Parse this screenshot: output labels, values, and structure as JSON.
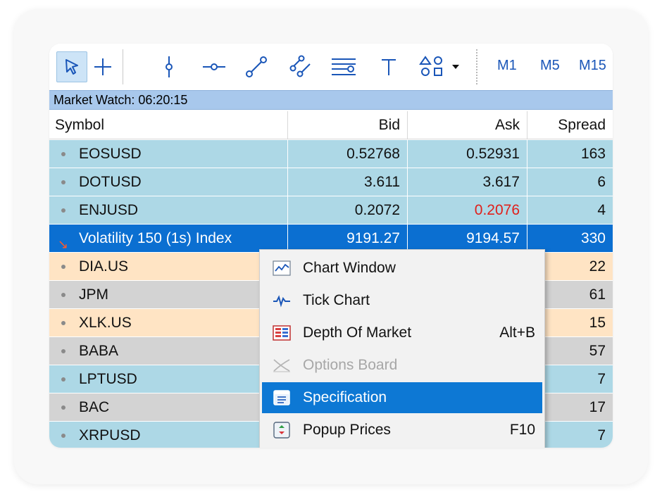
{
  "toolbar": {
    "tools": [
      {
        "icon": "cursor-icon"
      },
      {
        "icon": "crosshair-icon"
      },
      {
        "icon": "vertical-line-icon"
      },
      {
        "icon": "horizontal-line-icon"
      },
      {
        "icon": "trend-line-icon"
      },
      {
        "icon": "channel-icon"
      },
      {
        "icon": "fibonacci-icon"
      },
      {
        "icon": "text-icon"
      },
      {
        "icon": "shapes-icon"
      }
    ],
    "periods": [
      "M1",
      "M5",
      "M15"
    ]
  },
  "market_watch": {
    "title": "Market Watch: 06:20:15",
    "columns": [
      "Symbol",
      "Bid",
      "Ask",
      "Spread"
    ],
    "rows": [
      {
        "symbol": "EOSUSD",
        "bid": "0.52768",
        "ask": "0.52931",
        "spread": "163"
      },
      {
        "symbol": "DOTUSD",
        "bid": "3.611",
        "ask": "3.617",
        "spread": "6"
      },
      {
        "symbol": "ENJUSD",
        "bid": "0.2072",
        "ask": "0.2076",
        "spread": "4"
      },
      {
        "symbol": "Volatility 150 (1s) Index",
        "bid": "9191.27",
        "ask": "9194.57",
        "spread": "330"
      },
      {
        "symbol": "DIA.US",
        "bid": "",
        "ask": "",
        "spread": "22"
      },
      {
        "symbol": "JPM",
        "bid": "",
        "ask": "",
        "spread": "61"
      },
      {
        "symbol": "XLK.US",
        "bid": "",
        "ask": "",
        "spread": "15"
      },
      {
        "symbol": "BABA",
        "bid": "",
        "ask": "",
        "spread": "57"
      },
      {
        "symbol": "LPTUSD",
        "bid": "",
        "ask": "",
        "spread": "7"
      },
      {
        "symbol": "BAC",
        "bid": "",
        "ask": "",
        "spread": "17"
      },
      {
        "symbol": "XRPUSD",
        "bid": "",
        "ask": "",
        "spread": "7"
      }
    ]
  },
  "context_menu": {
    "items": [
      {
        "label": "Chart Window",
        "shortcut": "",
        "icon": "chart-window-icon"
      },
      {
        "label": "Tick Chart",
        "shortcut": "",
        "icon": "tick-chart-icon"
      },
      {
        "label": "Depth Of Market",
        "shortcut": "Alt+B",
        "icon": "depth-of-market-icon"
      },
      {
        "label": "Options Board",
        "shortcut": "",
        "icon": "options-board-icon"
      },
      {
        "label": "Specification",
        "shortcut": "",
        "icon": "specification-icon"
      },
      {
        "label": "Popup Prices",
        "shortcut": "F10",
        "icon": "popup-prices-icon"
      }
    ]
  },
  "colors": {
    "row_blue": "#add8e6",
    "row_peach": "#ffe4c4",
    "row_gray": "#d3d3d3",
    "selected_row": "#0b6fd1",
    "ask_down": "#e0201b",
    "menu_highlight": "#0d78d4",
    "title_bar": "#a8c8ec",
    "period_text": "#1a56b8"
  }
}
